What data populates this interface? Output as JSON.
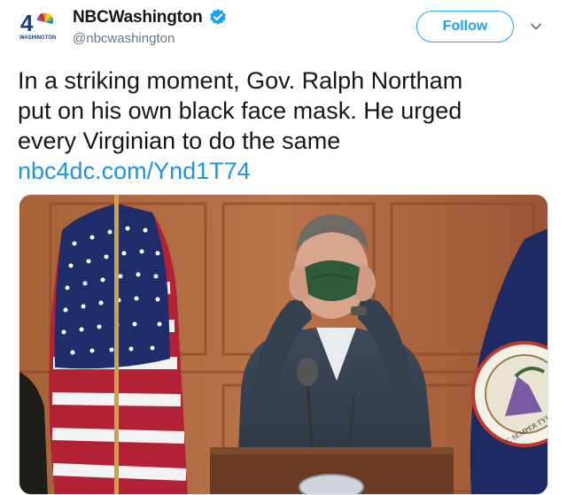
{
  "account": {
    "display_name": "NBCWashington",
    "handle": "@nbcwashington",
    "logo_number": "4",
    "logo_text": "WASHINGTON",
    "verified": true
  },
  "actions": {
    "follow_label": "Follow"
  },
  "tweet": {
    "lines": [
      "In a striking moment, Gov. Ralph Northam",
      "put on his own black face mask. He urged",
      "every Virginian to do the same"
    ],
    "link": "nbc4dc.com/Ynd1T74"
  },
  "media": {
    "description_icon": "photo",
    "seal_text": "SIC SEMPER TYRANNIS"
  },
  "colors": {
    "brand_blue": "#1da1f2",
    "link_blue": "#1b95e0",
    "text_primary": "#14171a",
    "text_secondary": "#657786"
  }
}
